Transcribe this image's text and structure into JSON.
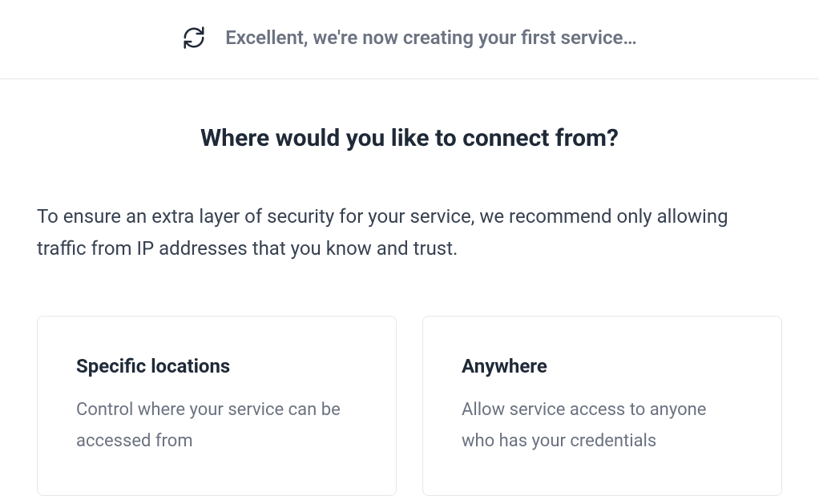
{
  "header": {
    "status_text": "Excellent, we're now creating your first service…"
  },
  "main": {
    "heading": "Where would you like to connect from?",
    "description": "To ensure an extra layer of security for your service, we recommend only allowing traffic from IP addresses that you know and trust."
  },
  "options": [
    {
      "title": "Specific locations",
      "description": "Control where your service can be accessed from"
    },
    {
      "title": "Anywhere",
      "description": "Allow service access to anyone who has your credentials"
    }
  ]
}
